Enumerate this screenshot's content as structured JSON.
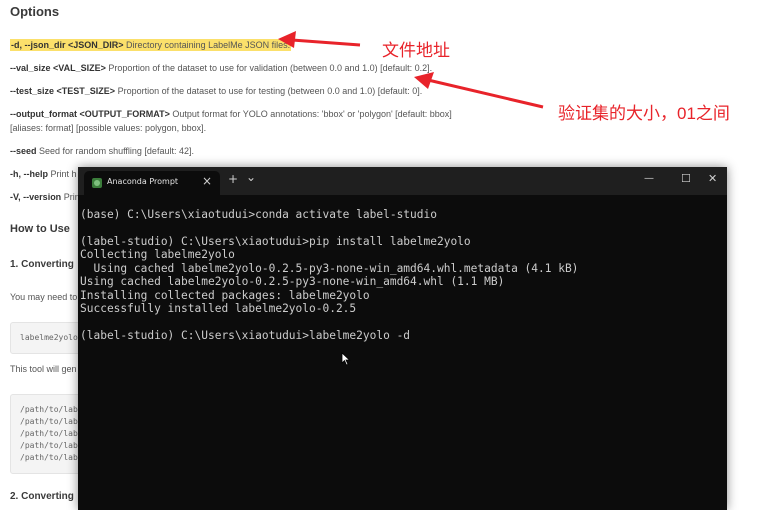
{
  "doc": {
    "options_heading": "Options",
    "opt_json_dir_flag": "-d, --json_dir <JSON_DIR>",
    "opt_json_dir_desc": "Directory containing LabelMe JSON files.",
    "opt_val_flag": "--val_size <VAL_SIZE>",
    "opt_val_desc": "Proportion of the dataset to use for validation (between 0.0 and 1.0) [default: 0.2].",
    "opt_test_flag": "--test_size <TEST_SIZE>",
    "opt_test_desc": "Proportion of the dataset to use for testing (between 0.0 and 1.0) [default: 0].",
    "opt_format_flag": "--output_format <OUTPUT_FORMAT>",
    "opt_format_desc": "Output format for YOLO annotations: 'bbox' or 'polygon' [default: bbox]",
    "opt_format_desc2": "[aliases: format] [possible values: polygon, bbox].",
    "opt_seed_flag": "--seed",
    "opt_seed_desc": "Seed for random shuffling [default: 42].",
    "opt_help_flag": "-h, --help",
    "opt_help_desc": "Print h",
    "opt_version_flag": "-V, --version",
    "opt_version_desc": "Prin",
    "how_to_use": "How to Use",
    "section1": "1. Converting",
    "para1": "You may need to",
    "code1": "labelme2yolo",
    "para2": "This tool will gen",
    "code2_lines": [
      "/path/to/lab",
      "/path/to/lab",
      "/path/to/lab",
      "/path/to/lab",
      "/path/to/lab"
    ],
    "section2": "2. Converting"
  },
  "annotations": {
    "file_address": "文件地址",
    "val_size_note": "验证集的大小，01之间",
    "color": "#e8232a"
  },
  "terminal": {
    "tab_title": "Anaconda Prompt",
    "tab_close": "×",
    "new_tab": "+",
    "dropdown": "⌄",
    "minimize": "—",
    "maximize": "☐",
    "close": "✕",
    "lines": [
      "(base) C:\\Users\\xiaotudui>conda activate label-studio",
      "",
      "(label-studio) C:\\Users\\xiaotudui>pip install labelme2yolo",
      "Collecting labelme2yolo",
      "  Using cached labelme2yolo-0.2.5-py3-none-win_amd64.whl.metadata (4.1 kB)",
      "Using cached labelme2yolo-0.2.5-py3-none-win_amd64.whl (1.1 MB)",
      "Installing collected packages: labelme2yolo",
      "Successfully installed labelme2yolo-0.2.5",
      "",
      "(label-studio) C:\\Users\\xiaotudui>labelme2yolo -d"
    ]
  }
}
